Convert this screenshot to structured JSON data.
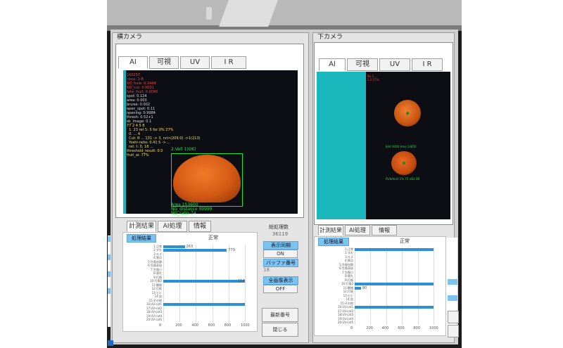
{
  "left_panel": {
    "title": "横カメラ",
    "tabs": [
      "AI",
      "可視",
      "UV",
      "I R"
    ],
    "overlay_lines": [
      "100257",
      "class: 2-B",
      "NO_hole: 0.3444",
      "NO_cut: 0.0001",
      "fake_fruit: 0.0000",
      "spot: 0.124",
      "area: 0.003",
      "bruise: 0.002",
      "open_spot: 0.11",
      "opening: 0.9984",
      "thresh: 0.52+1",
      "ok_image: 0.1",
      "77 2 4 5 8",
      "  1. 23 ret 5: 5 for 0% 27%",
      "  0. ... 4",
      "  Cut: R ... 131 -> 3, rvl>(209 0) ->1(213)",
      "  Yoshi-ratio: 0.41 S -> ...",
      "  ret: t: 0, 18 ...",
      "threshold_result: 0.0",
      "fruit_ai: 77%"
    ],
    "detection_label": "2:Vell 1(OK)",
    "detection_info": [
      "Area 153600",
      "NG_distance 99999",
      "NG_ratio 74"
    ],
    "bottom_tabs": [
      "計測結果",
      "AI処理",
      "情報"
    ],
    "result_label": "処理結果",
    "result_status": "正常",
    "chart_data": {
      "type": "bar",
      "orientation": "horizontal",
      "categories": [
        "1:正常",
        "2:すれ",
        "3:キズ",
        "4:黒点",
        "5:生傷虫跡",
        "6:生傷非斑",
        "7:生傷小",
        "8:腐れ",
        "9:打傷",
        "10:打傷2",
        "11:鬱病",
        "12:打痕",
        "13:ヒビ",
        "14:虫",
        "15:その他",
        "16:UV-cat1",
        "17:UV-cat2",
        "18:UV-cat3",
        "19:UV-cat4",
        "20:UV-cat5"
      ],
      "values": [
        263,
        779,
        0,
        0,
        0,
        0,
        0,
        0,
        0,
        1000,
        0,
        0,
        0,
        0,
        0,
        1000,
        0,
        0,
        0,
        0
      ],
      "value_labels": [
        "263",
        "779",
        "",
        "",
        "",
        "",
        "",
        "",
        "",
        "114",
        "",
        "",
        "",
        "",
        "",
        "",
        "",
        "",
        "",
        ""
      ],
      "xticks": [
        "0",
        "200",
        "400",
        "600",
        "800",
        "1000"
      ],
      "xlim": [
        0,
        1000
      ]
    }
  },
  "controls": {
    "count_label": "総処理数",
    "count_value": "36119",
    "display_sync_label": "表示同期",
    "display_sync_value": "ON",
    "buffer_label": "バッファ番号",
    "buffer_value": "18",
    "all_display_label": "全画像表示",
    "all_display_value": "OFF",
    "latest_button": "最新番号",
    "close_button": "閉じる"
  },
  "right_panel": {
    "title": "下カメラ",
    "tabs": [
      "AI",
      "可視",
      "UV",
      "I R"
    ],
    "overlay_top": "Nu 2 ...\n1.0 27%",
    "detection_label_1": "Edd 3000 Area 13850",
    "detection_label_2": "RUdetect 2% 75 nGe 86",
    "bottom_tabs": [
      "計測結果",
      "AI処理",
      "情報"
    ],
    "result_label": "処理結果",
    "result_status": "正常",
    "chart_data": {
      "type": "bar",
      "orientation": "horizontal",
      "categories": [
        "1:正常",
        "2:すれ",
        "3:キズ",
        "4:黒点",
        "5:生傷虫跡",
        "6:生傷非斑",
        "7:生傷小",
        "8:腐れ",
        "9:打傷",
        "10:打傷2",
        "11:鬱病",
        "12:打痕",
        "13:ヒビ",
        "14:虫",
        "15:その他",
        "16:UV-cat1",
        "17:UV-cat2",
        "18:UV-cat3",
        "19:UV-cat4",
        "20:UV-cat5"
      ],
      "values": [
        1000,
        0,
        0,
        0,
        0,
        0,
        0,
        0,
        0,
        1000,
        80,
        0,
        0,
        0,
        0,
        1000,
        0,
        0,
        0,
        0
      ],
      "value_labels": [
        "",
        "",
        "",
        "",
        "",
        "",
        "",
        "",
        "",
        "",
        "80",
        "",
        "",
        "",
        "",
        "",
        "",
        "",
        "",
        ""
      ],
      "xticks": [
        "0",
        "200",
        "400",
        "600",
        "800",
        "1000"
      ],
      "xlim": [
        0,
        1000
      ]
    }
  },
  "colors": {
    "teal": "#1ab7bd",
    "detection_green": "#19e33c",
    "bar_blue": "#2f8fd6",
    "overlay_red": "#ff3b3b",
    "overlay_yellow": "#f2e34d"
  }
}
